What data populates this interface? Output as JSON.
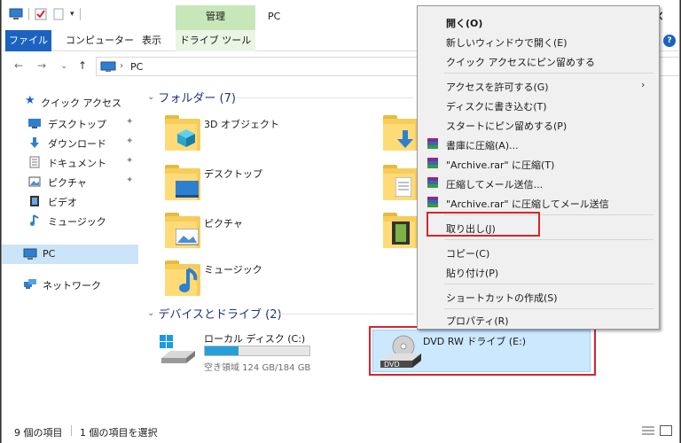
{
  "title": {
    "context_tab_header": "管理",
    "window_title": "PC",
    "close_glyph": "×"
  },
  "ribbon": {
    "tabs": [
      "ファイル",
      "コンピューター",
      "表示",
      "ドライブ ツール"
    ],
    "help_glyph": "?"
  },
  "address": {
    "back": "←",
    "forward": "→",
    "recent": "⌄",
    "up": "↑",
    "separator": "›",
    "crumb": "PC"
  },
  "nav": {
    "quick_access": "クイック アクセス",
    "items": [
      {
        "label": "デスクトップ",
        "pinned": true
      },
      {
        "label": "ダウンロード",
        "pinned": true
      },
      {
        "label": "ドキュメント",
        "pinned": true
      },
      {
        "label": "ピクチャ",
        "pinned": true
      },
      {
        "label": "ビデオ",
        "pinned": false
      },
      {
        "label": "ミュージック",
        "pinned": false
      }
    ],
    "pc": "PC",
    "network": "ネットワーク",
    "pin_glyph": "📌"
  },
  "content": {
    "folders_header": "フォルダー (7)",
    "folders": [
      {
        "label": "3D オブジェクト"
      },
      {
        "label": "デスクトップ"
      },
      {
        "label": "ピクチャ"
      },
      {
        "label": "ミュージック"
      }
    ],
    "devices_header": "デバイスとドライブ (2)",
    "local_disk": {
      "label": "ローカル ディスク (C:)",
      "free_text": "空き領域 124 GB/184 GB",
      "used_fraction": 0.326
    },
    "dvd": {
      "label": "DVD RW ドライブ (E:)",
      "icon_text": "DVD"
    }
  },
  "status": {
    "items": "9 個の項目",
    "selected": "1 個の項目を選択"
  },
  "context_menu": {
    "items": [
      {
        "label": "開く(O)",
        "bold": true
      },
      {
        "label": "新しいウィンドウで開く(E)"
      },
      {
        "label": "クイック アクセスにピン留めする"
      },
      {
        "label": "アクセスを許可する(G)",
        "submenu": true
      },
      {
        "label": "ディスクに書き込む(T)"
      },
      {
        "label": "スタートにピン留めする(P)"
      },
      {
        "label": "書庫に圧縮(A)..."
      },
      {
        "label": "\"Archive.rar\" に圧縮(T)"
      },
      {
        "label": "圧縮してメール送信..."
      },
      {
        "label": "\"Archive.rar\" に圧縮してメール送信"
      },
      {
        "label": "取り出し(J)"
      },
      {
        "label": "コピー(C)"
      },
      {
        "label": "貼り付け(P)"
      },
      {
        "label": "ショートカットの作成(S)"
      },
      {
        "label": "プロパティ(R)"
      }
    ],
    "submenu_arrow": "›"
  },
  "colors": {
    "accent": "#1a63c1",
    "highlight_box": "#d9232d",
    "selection": "#cce8ff",
    "drive_fill": "#26a0da",
    "manage_tab": "#c7e7b9"
  }
}
